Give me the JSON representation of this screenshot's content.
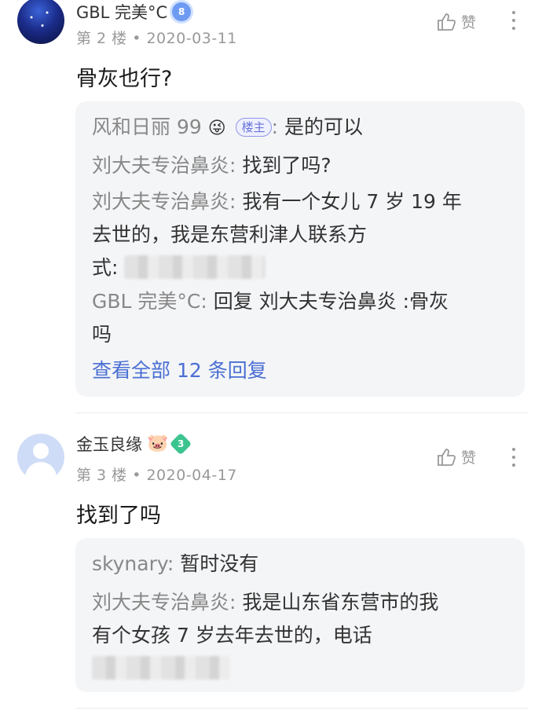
{
  "posts": [
    {
      "username": "GBL 完美°C",
      "level": "8",
      "floor": "第 2 楼",
      "date": "2020-03-11",
      "like_label": "赞",
      "content": "骨灰也行?",
      "replies": [
        {
          "name": "风和日丽 99",
          "emoji": "😜",
          "tag": "楼主",
          "sep": ":",
          "text": "是的可以"
        },
        {
          "name": "刘大夫专治鼻炎",
          "sep": ":",
          "text": "找到了吗?"
        },
        {
          "name": "刘大夫专治鼻炎",
          "sep": ":",
          "text": "我有一个女儿 7 岁 19 年",
          "line2": "去世的，我是东营利津人联系方",
          "line3": "式:"
        },
        {
          "name": "GBL 完美°C",
          "sep": ":",
          "text": "回复 刘大夫专治鼻炎 :骨灰",
          "line2": "吗"
        }
      ],
      "view_all": "查看全部 12 条回复"
    },
    {
      "username": "金玉良缘",
      "emoji": "🐷",
      "level": "3",
      "floor": "第 3 楼",
      "date": "2020-04-17",
      "like_label": "赞",
      "content": "找到了吗",
      "replies": [
        {
          "name": "skynary",
          "sep": ":",
          "text": "暂时没有"
        },
        {
          "name": "刘大夫专治鼻炎",
          "sep": ":",
          "text": "我是山东省东营市的我",
          "line2": "有个女孩 7 岁去年去世的，电话"
        }
      ]
    }
  ],
  "colors": {
    "link": "#4a6fd3",
    "muted": "#999999",
    "reply_bg": "#f4f5f7",
    "level_blue": "#6e9bf2",
    "level_green": "#3cc48f"
  }
}
